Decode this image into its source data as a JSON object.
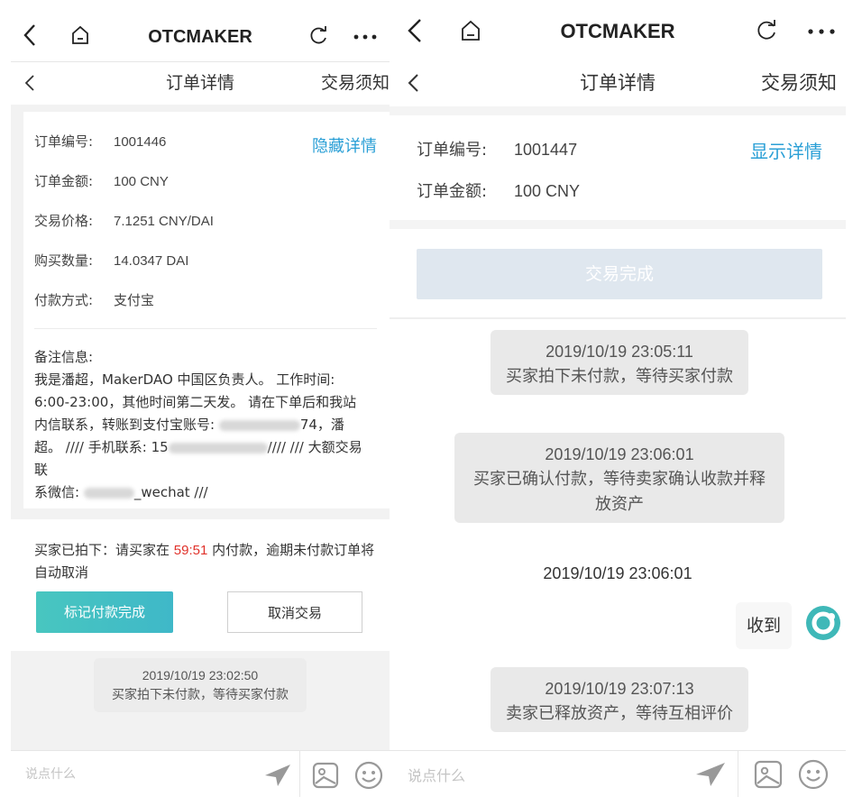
{
  "app": {
    "title": "OTCMAKER"
  },
  "colors": {
    "link": "#2a9fd6",
    "accent": "#45c0c4",
    "timer": "#e0312a"
  },
  "left": {
    "sub": {
      "title": "订单详情",
      "right": "交易须知"
    },
    "toggle_label": "隐藏详情",
    "fields": [
      {
        "key": "订单编号:",
        "value": "1001446"
      },
      {
        "key": "订单金额:",
        "value": "100 CNY"
      },
      {
        "key": "交易价格:",
        "value": "7.1251 CNY/DAI"
      },
      {
        "key": "购买数量:",
        "value": "14.0347 DAI"
      },
      {
        "key": "付款方式:",
        "value": "支付宝"
      }
    ],
    "note": {
      "heading": "备注信息:",
      "line1": "我是潘超，MakerDAO 中国区负责人。 工作时间:",
      "line2": "6:00-23:00，其他时间第二天发。 请在下单后和我站",
      "line3a": "内信联系，转账到支付宝账号: ",
      "line3b": "74，潘",
      "line4a": "超。 //// 手机联系: 15",
      "line4b": "//// /// 大额交易联",
      "line5a": "系微信: ",
      "line5b": "_wechat ///"
    },
    "hint": {
      "prefix": "买家已拍下：请买家在 ",
      "timer": "59:51",
      "suffix": " 内付款，逾期未付款订单将自动取消"
    },
    "mark_paid_label": "标记付款完成",
    "cancel_label": "取消交易",
    "chat": [
      {
        "time": "2019/10/19 23:02:50",
        "text": "买家拍下未付款，等待买家付款"
      }
    ],
    "input_placeholder": "说点什么"
  },
  "right": {
    "sub": {
      "title": "订单详情",
      "right": "交易须知"
    },
    "toggle_label": "显示详情",
    "fields": [
      {
        "key": "订单编号:",
        "value": "1001447"
      },
      {
        "key": "订单金额:",
        "value": "100 CNY"
      }
    ],
    "complete_label": "交易完成",
    "chat": [
      {
        "time": "2019/10/19 23:05:11",
        "text": "买家拍下未付款，等待买家付款"
      },
      {
        "time": "2019/10/19 23:06:01",
        "text1": "买家已确认付款，等待卖家确认收款并释",
        "text2": "放资产"
      },
      {
        "time": "2019/10/19 23:06:01"
      },
      {
        "reply": "收到"
      },
      {
        "time": "2019/10/19 23:07:13",
        "text": "卖家已释放资产，等待互相评价"
      }
    ],
    "input_placeholder": "说点什么"
  }
}
